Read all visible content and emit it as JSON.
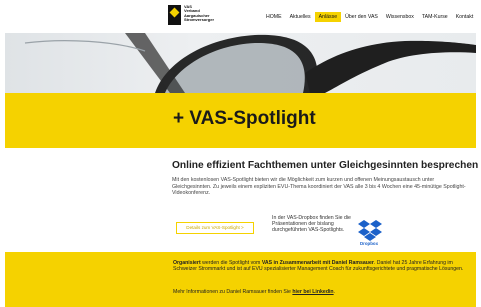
{
  "logo": {
    "line1": "VAS",
    "line2": "Verband",
    "line3": "Aargauischer",
    "line4": "Stromversorger"
  },
  "nav": [
    {
      "label": "HOME"
    },
    {
      "label": "Aktuelles"
    },
    {
      "label": "Anlässe",
      "active": true
    },
    {
      "label": "Über den VAS"
    },
    {
      "label": "Wissensbox"
    },
    {
      "label": "TAM-Kurse"
    },
    {
      "label": "Kontakt"
    }
  ],
  "band": {
    "title": "+ VAS-Spotlight"
  },
  "main": {
    "heading": "Online effizient Fachthemen unter Gleichgesinnten besprechen",
    "intro": "Mit den kostenlosen VAS-Spotlight bieten wir die Möglichkeit zum kurzen und offenen Meinungsaustausch unter Gleichgesinnten. Zu jeweils einem expliziten EVU-Thema koordiniert der VAS alle 3 bis 4 Wochen eine 45-minütige Spotlight-Videokonferenz.",
    "button_label": "Details zum VAS-Spotlight >",
    "dropbox_text": "In der VAS-Dropbox finden Sie die Präsentationen der bislang durchgeführten VAS-Spotlights.",
    "dropbox_label": "Dropbox"
  },
  "bottom": {
    "org_bold1": "Organisiert",
    "org_text1": " werden die Spotlight vom ",
    "org_bold2": "VAS in Zusammenarbeit mit Daniel Ramsauer",
    "org_text2": ". Daniel hat 25 Jahre Erfahrung im Schweizer Strommarkt und ist auf EVU spezialisierter Management Coach für zukunftsgerichtete und pragmatische Lösungen.",
    "more_text": "Mehr Informationen zu Daniel Ramsauer finden Sie ",
    "more_link": "hier bei Linkedin",
    "more_end": "."
  },
  "colors": {
    "accent": "#f5d200"
  }
}
